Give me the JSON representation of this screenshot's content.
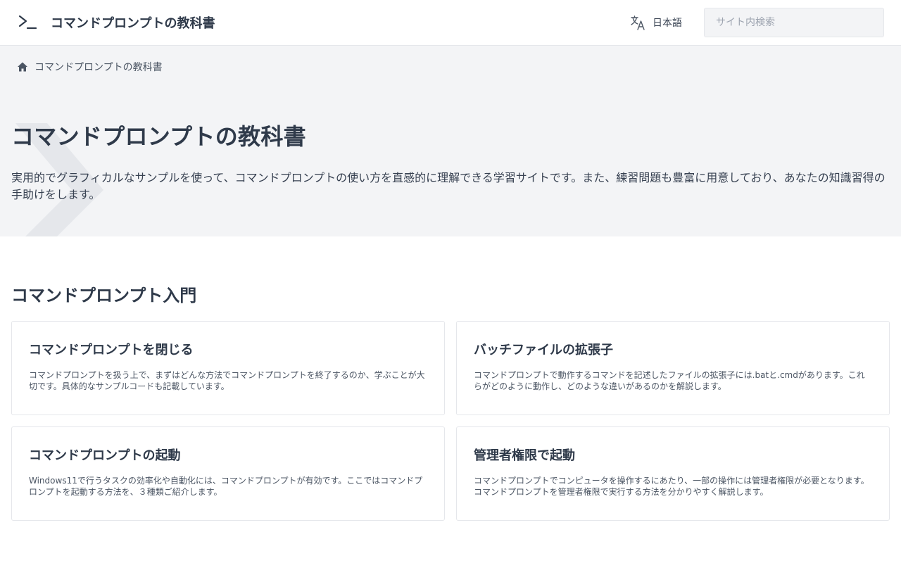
{
  "header": {
    "brand_title": "コマンドプロンプトの教科書",
    "brand_icon": "terminal-icon",
    "language_label": "日本語",
    "language_icon": "translate-icon",
    "search_placeholder": "サイト内検索",
    "search_value": ""
  },
  "breadcrumb": {
    "icon": "home-icon",
    "label": "コマンドプロンプトの教科書"
  },
  "hero": {
    "title": "コマンドプロンプトの教科書",
    "description": "実用的でグラフィカルなサンプルを使って、コマンドプロンプトの使い方を直感的に理解できる学習サイトです。また、練習問題も豊富に用意しており、あなたの知識習得の手助けをします。"
  },
  "section": {
    "title": "コマンドプロンプト入門",
    "cards": [
      {
        "title": "コマンドプロンプトを閉じる",
        "description": "コマンドプロンプトを扱う上で、まずはどんな方法でコマンドプロンプトを終了するのか、学ぶことが大切です。具体的なサンプルコードも記載しています。"
      },
      {
        "title": "バッチファイルの拡張子",
        "description": "コマンドプロンプトで動作するコマンドを記述したファイルの拡張子には.batと.cmdがあります。これらがどのように動作し、どのような違いがあるのかを解説します。"
      },
      {
        "title": "コマンドプロンプトの起動",
        "description": "Windows11で行うタスクの効率化や自動化には、コマンドプロンプトが有効です。ここではコマンドプロンプトを起動する方法を、３種類ご紹介します。"
      },
      {
        "title": "管理者権限で起動",
        "description": "コマンドプロンプトでコンピュータを操作するにあたり、一部の操作には管理者権限が必要となります。コマンドプロンプトを管理者権限で実行する方法を分かりやすく解説します。"
      }
    ]
  },
  "colors": {
    "text": "#2f3a4a",
    "hero_background": "#f3f4f6",
    "border": "#e5e7eb"
  }
}
